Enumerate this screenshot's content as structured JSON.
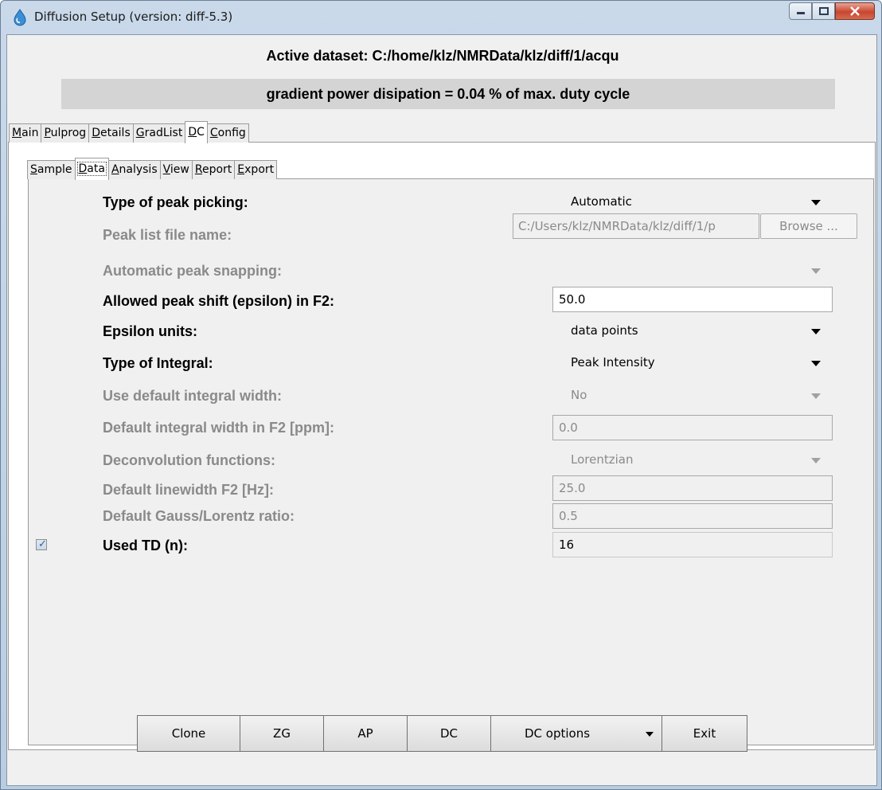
{
  "window": {
    "title": "Diffusion Setup (version: diff-5.3)"
  },
  "header": {
    "dataset": "Active dataset: C:/home/klz/NMRData/klz/diff/1/acqu",
    "power": "gradient power disipation = 0.04 % of max. duty cycle"
  },
  "main_tabs": [
    {
      "label": "Main",
      "mnemonic": "M",
      "rest": "ain"
    },
    {
      "label": "Pulprog",
      "mnemonic": "P",
      "rest": "ulprog"
    },
    {
      "label": "Details",
      "mnemonic": "D",
      "rest": "etails"
    },
    {
      "label": "GradList",
      "mnemonic": "G",
      "rest": "radList"
    },
    {
      "label": "DC",
      "mnemonic": "D",
      "rest": "C",
      "active": true
    },
    {
      "label": "Config",
      "mnemonic": "C",
      "rest": "onfig"
    }
  ],
  "sub_tabs": [
    {
      "label": "Sample",
      "mnemonic": "S",
      "rest": "ample"
    },
    {
      "label": "Data",
      "mnemonic": "D",
      "rest": "ata",
      "active": true
    },
    {
      "label": "Analysis",
      "mnemonic": "A",
      "rest": "nalysis"
    },
    {
      "label": "View",
      "mnemonic": "V",
      "rest": "iew"
    },
    {
      "label": "Report",
      "mnemonic": "R",
      "rest": "eport"
    },
    {
      "label": "Export",
      "mnemonic": "E",
      "rest": "xport"
    }
  ],
  "form": {
    "peak_picking": {
      "label": "Type of peak picking:",
      "value": "Automatic"
    },
    "peak_list_file": {
      "label": "Peak list file name:",
      "value": "C:/Users/klz/NMRData/klz/diff/1/p",
      "button": "Browse ..."
    },
    "peak_snapping": {
      "label": "Automatic peak snapping:",
      "value": ""
    },
    "peak_shift": {
      "label": "Allowed peak shift (epsilon) in F2:",
      "value": "50.0"
    },
    "epsilon_units": {
      "label": "Epsilon units:",
      "value": "data points"
    },
    "integral_type": {
      "label": "Type of Integral:",
      "value": "Peak Intensity"
    },
    "default_integral_width": {
      "label": "Use default integral width:",
      "value": "No"
    },
    "integral_width_f2": {
      "label": "Default integral width in F2 [ppm]:",
      "value": "0.0"
    },
    "deconvolution": {
      "label": "Deconvolution functions:",
      "value": "Lorentzian"
    },
    "linewidth_f2": {
      "label": "Default linewidth F2 [Hz]:",
      "value": "25.0"
    },
    "gauss_lorentz": {
      "label": "Default Gauss/Lorentz ratio:",
      "value": "0.5"
    },
    "used_td": {
      "label": "Used TD (n):",
      "value": "16",
      "checked": true
    }
  },
  "buttons": {
    "clone": "Clone",
    "zg": "ZG",
    "ap": "AP",
    "dc": "DC",
    "dc_options": "DC options",
    "exit": "Exit"
  }
}
